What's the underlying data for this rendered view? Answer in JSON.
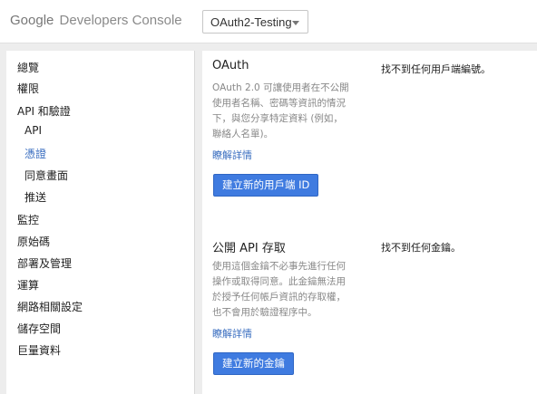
{
  "header": {
    "brand": "Google",
    "product": "Developers Console",
    "project_selector": {
      "selected": "OAuth2-Testing"
    }
  },
  "sidebar": {
    "items": [
      {
        "label": "總覽"
      },
      {
        "label": "權限"
      },
      {
        "label": "API 和驗證"
      },
      {
        "label": "API"
      },
      {
        "label": "憑證"
      },
      {
        "label": "同意畫面"
      },
      {
        "label": "推送"
      },
      {
        "label": "監控"
      },
      {
        "label": "原始碼"
      },
      {
        "label": "部署及管理"
      },
      {
        "label": "運算"
      },
      {
        "label": "網路相關設定"
      },
      {
        "label": "儲存空間"
      },
      {
        "label": "巨量資料"
      }
    ]
  },
  "oauth": {
    "title": "OAuth",
    "description": [
      "OAuth 2.0 可讓使用者在不公開",
      "使用者名稱、密碼等資訊的情況",
      "下，與您分享特定資料 (例如，",
      "聯絡人名單)。"
    ],
    "learn_more": "瞭解詳情",
    "button": "建立新的用戶端 ID",
    "status": "找不到任何用戶端編號。"
  },
  "public_api": {
    "title": "公開 API 存取",
    "description": [
      "使用這個金鑰不必事先進行任何",
      "操作或取得同意。此金鑰無法用",
      "於授予任何帳戶資訊的存取權，",
      "也不會用於驗證程序中。"
    ],
    "learn_more": "瞭解詳情",
    "button": "建立新的金鑰",
    "status": "找不到任何金鑰。"
  },
  "colors": {
    "link": "#3a6ec0",
    "button": "#3f7be0",
    "background": "#ededed"
  }
}
